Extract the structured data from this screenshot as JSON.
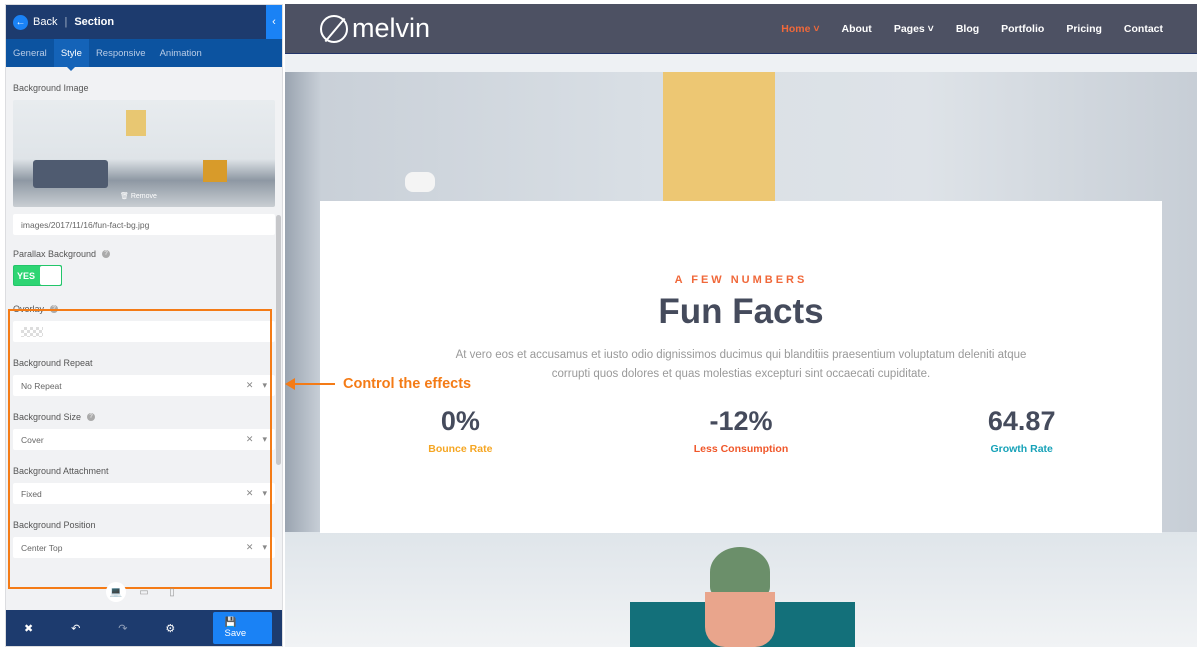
{
  "panel": {
    "back": "Back",
    "title": "Section",
    "tabs": [
      "General",
      "Style",
      "Responsive",
      "Animation"
    ],
    "bg_image_label": "Background Image",
    "remove": "Remove",
    "bg_image_path": "images/2017/11/16/fun-fact-bg.jpg",
    "parallax_label": "Parallax Background",
    "parallax_value": "YES",
    "overlay_label": "Overlay",
    "repeat_label": "Background Repeat",
    "repeat_value": "No Repeat",
    "size_label": "Background Size",
    "size_value": "Cover",
    "attachment_label": "Background Attachment",
    "attachment_value": "Fixed",
    "position_label": "Background Position",
    "position_value": "Center Top",
    "save": "Save"
  },
  "callout": "Control the effects",
  "site": {
    "logo": "melvin",
    "menu": [
      "Home",
      "About",
      "Pages",
      "Blog",
      "Portfolio",
      "Pricing",
      "Contact"
    ],
    "kicker": "A FEW NUMBERS",
    "title": "Fun Facts",
    "description": "At vero eos et accusamus et iusto odio dignissimos ducimus qui blanditiis praesentium voluptatum deleniti atque corrupti quos dolores et quas molestias excepturi sint occaecati cupiditate.",
    "facts": [
      {
        "value": "0%",
        "label": "Bounce Rate",
        "color": "#f5a623"
      },
      {
        "value": "-12%",
        "label": "Less Consumption",
        "color": "#f0572a"
      },
      {
        "value": "64.87",
        "label": "Growth Rate",
        "color": "#17a2b8"
      }
    ]
  },
  "colors": {
    "accent": "#1a82f5",
    "highlight": "#f47b16",
    "header": "#1d3b6e"
  }
}
